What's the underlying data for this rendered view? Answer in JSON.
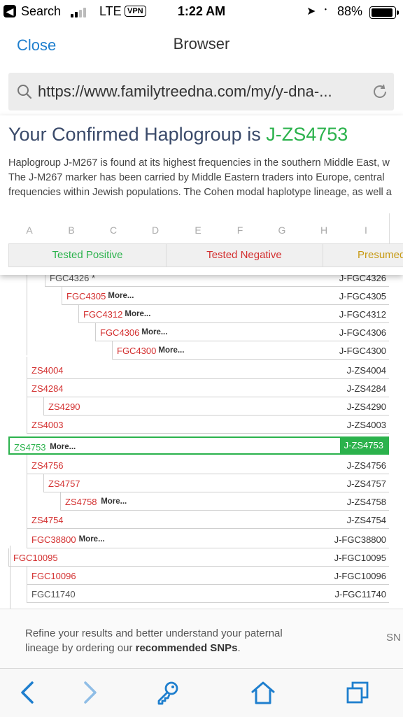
{
  "status_bar": {
    "carrier": "Search",
    "network": "LTE",
    "vpn": "VPN",
    "time": "1:22 AM",
    "battery": "88%"
  },
  "nav": {
    "close_label": "Close",
    "title": "Browser"
  },
  "url_bar": {
    "url": "https://www.familytreedna.com/my/y-dna-..."
  },
  "popup": {
    "heading_prefix": "Your Confirmed Haplogroup is ",
    "heading_haplogroup": "J-ZS4753",
    "description_lines": [
      "Haplogroup J-M267 is found at its highest frequencies in the southern Middle East, w",
      "The J-M267 marker has been carried by Middle Eastern traders into Europe, central ",
      "frequencies within Jewish populations. The Cohen modal haplotype lineage, as well a"
    ],
    "column_letters": [
      "A",
      "B",
      "C",
      "D",
      "E",
      "F",
      "G",
      "H",
      "I"
    ],
    "legend": {
      "tested_positive": "Tested Positive",
      "tested_negative": "Tested Negative",
      "presumed": "Presumed"
    }
  },
  "tree": {
    "rows": [
      {
        "snp": "FGC4326 *",
        "haplogroup": "J-FGC4326",
        "more": "",
        "status": "grey"
      },
      {
        "snp": "FGC4305",
        "haplogroup": "J-FGC4305",
        "more": "More...",
        "status": "negative"
      },
      {
        "snp": "FGC4312",
        "haplogroup": "J-FGC4312",
        "more": "More...",
        "status": "negative"
      },
      {
        "snp": "FGC4306",
        "haplogroup": "J-FGC4306",
        "more": "More...",
        "status": "negative"
      },
      {
        "snp": "FGC4300",
        "haplogroup": "J-FGC4300",
        "more": "More...",
        "status": "negative"
      },
      {
        "snp": "ZS4004",
        "haplogroup": "J-ZS4004",
        "more": "",
        "status": "negative"
      },
      {
        "snp": "ZS4284",
        "haplogroup": "J-ZS4284",
        "more": "",
        "status": "negative"
      },
      {
        "snp": "ZS4290",
        "haplogroup": "J-ZS4290",
        "more": "",
        "status": "negative"
      },
      {
        "snp": "ZS4003",
        "haplogroup": "J-ZS4003",
        "more": "",
        "status": "negative"
      },
      {
        "snp": "ZS4753",
        "haplogroup": "J-ZS4753",
        "more": "More...",
        "status": "positive"
      },
      {
        "snp": "ZS4756",
        "haplogroup": "J-ZS4756",
        "more": "",
        "status": "negative"
      },
      {
        "snp": "ZS4757",
        "haplogroup": "J-ZS4757",
        "more": "",
        "status": "negative"
      },
      {
        "snp": "ZS4758",
        "haplogroup": "J-ZS4758",
        "more": "More...",
        "status": "negative"
      },
      {
        "snp": "ZS4754",
        "haplogroup": "J-ZS4754",
        "more": "",
        "status": "negative"
      },
      {
        "snp": "FGC38800",
        "haplogroup": "J-FGC38800",
        "more": "More...",
        "status": "negative"
      },
      {
        "snp": "FGC10095",
        "haplogroup": "J-FGC10095",
        "more": "",
        "status": "negative"
      },
      {
        "snp": "FGC10096",
        "haplogroup": "J-FGC10096",
        "more": "",
        "status": "negative"
      },
      {
        "snp": "FGC11740",
        "haplogroup": "J-FGC11740",
        "more": "",
        "status": "grey"
      }
    ]
  },
  "recommend": {
    "text_before": "Refine your results and better understand your paternal lineage by ordering our ",
    "text_bold": "recommended SNPs",
    "text_after": ".",
    "side_label": "SN"
  },
  "toolbar": {
    "icons": [
      "back-icon",
      "forward-icon",
      "key-icon",
      "home-icon",
      "tabs-icon"
    ]
  },
  "colors": {
    "positive": "#2bb24c",
    "negative": "#d32f2f",
    "presumed": "#c79a14",
    "link_blue": "#1f7fce",
    "toolbar_blue": "#1f7fce"
  }
}
